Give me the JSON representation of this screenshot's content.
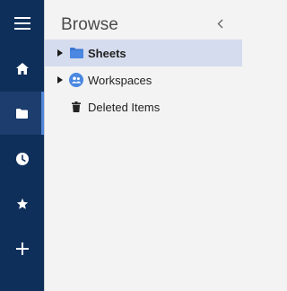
{
  "rail": {
    "items": [
      {
        "name": "menu",
        "icon": "hamburger-menu-icon"
      },
      {
        "name": "home",
        "icon": "home-icon"
      },
      {
        "name": "browse",
        "icon": "folder-icon",
        "active": true
      },
      {
        "name": "recents",
        "icon": "clock-icon"
      },
      {
        "name": "favorites",
        "icon": "star-icon"
      },
      {
        "name": "create",
        "icon": "plus-icon"
      }
    ],
    "colors": {
      "background": "#0f2f5b",
      "active": "#1c3d6d",
      "accent": "#4f86d9"
    }
  },
  "panel": {
    "title": "Browse",
    "collapse_icon": "chevron-left-icon",
    "tree": [
      {
        "label": "Sheets",
        "icon": "folder-icon",
        "expandable": true,
        "selected": true
      },
      {
        "label": "Workspaces",
        "icon": "workspaces-icon",
        "expandable": true,
        "selected": false
      },
      {
        "label": "Deleted Items",
        "icon": "trash-icon",
        "expandable": false,
        "selected": false
      }
    ]
  }
}
